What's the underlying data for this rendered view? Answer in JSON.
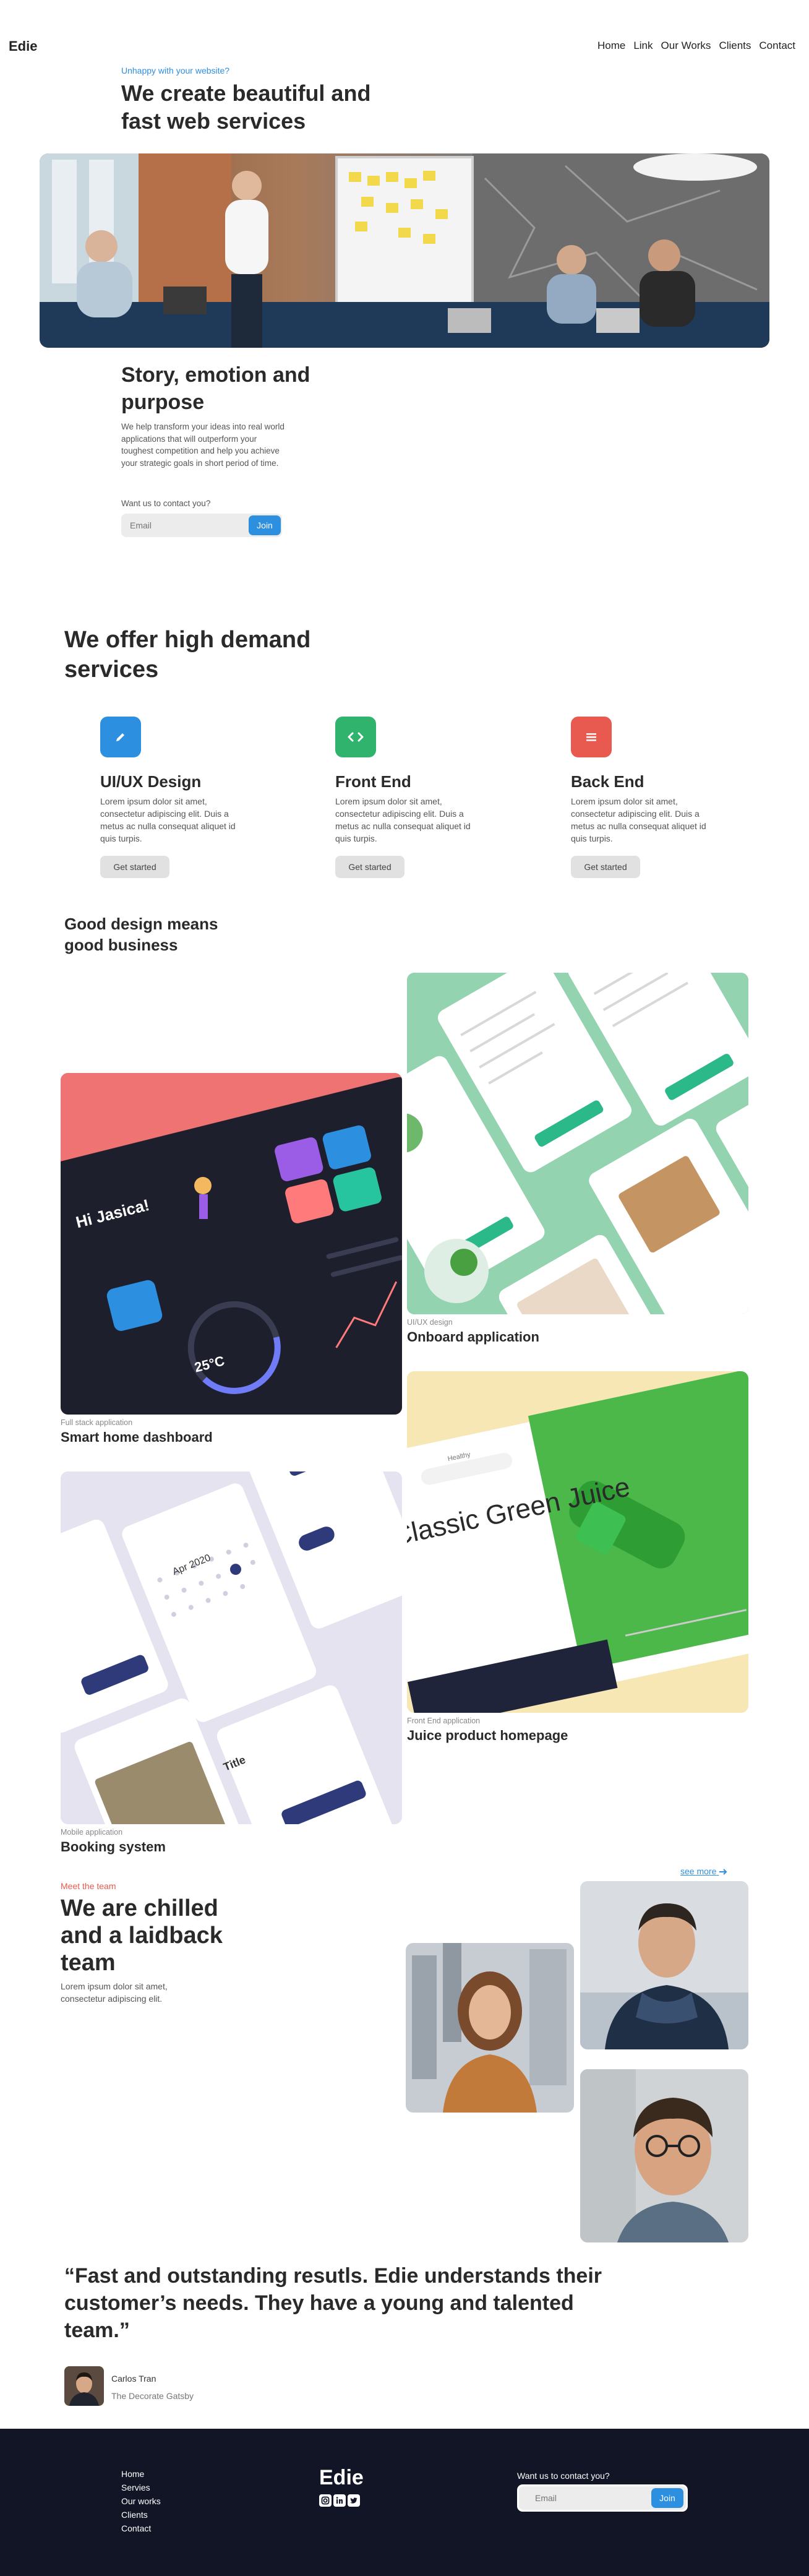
{
  "nav": {
    "brand": "Edie",
    "links": [
      "Home",
      "Link",
      "Our Works",
      "Clients",
      "Contact"
    ]
  },
  "hero": {
    "eyebrow": "Unhappy with your website?",
    "title": "We create beautiful and fast web services"
  },
  "story": {
    "title": "Story, emotion and purpose",
    "text": "We help transform your ideas into real world applications that will outperform your toughest competition and help you achieve your strategic goals in short period of time.",
    "contact_label": "Want us to contact you?",
    "email_placeholder": "Email",
    "join_label": "Join"
  },
  "services": {
    "title": "We offer high demand services",
    "items": [
      {
        "title": "UI/UX Design",
        "text": "Lorem ipsum dolor sit amet, consectetur adipiscing elit. Duis a metus ac nulla consequat aliquet id quis turpis.",
        "button": "Get started",
        "icon": "pencil-icon",
        "color": "#2d8fe0"
      },
      {
        "title": "Front End",
        "text": "Lorem ipsum dolor sit amet, consectetur adipiscing elit. Duis a metus ac nulla consequat aliquet id quis turpis.",
        "button": "Get started",
        "icon": "code-icon",
        "color": "#2fb36d"
      },
      {
        "title": "Back End",
        "text": "Lorem ipsum dolor sit amet, consectetur adipiscing elit. Duis a metus ac nulla consequat aliquet id quis turpis.",
        "button": "Get started",
        "icon": "menu-icon",
        "color": "#e8594f"
      }
    ]
  },
  "works": {
    "title": "Good design means good business",
    "items": [
      {
        "category": "UI/UX design",
        "name": "Onboard application"
      },
      {
        "category": "Full stack application",
        "name": "Smart home dashboard"
      },
      {
        "category": "Front End application",
        "name": "Juice product homepage"
      },
      {
        "category": "Mobile application",
        "name": "Booking system"
      }
    ],
    "mockups": {
      "dashboard_greeting": "Hi Jasica!",
      "dashboard_temp": "25°C",
      "juice_heading": "Classic Green Juice",
      "juice_search": "Healthy",
      "booking_month": "Apr 2020",
      "booking_title": "Title"
    }
  },
  "team": {
    "eyebrow": "Meet the team",
    "title": "We are chilled and a laidback team",
    "text": "Lorem ipsum dolor sit amet, consectetur adipiscing elit.",
    "see_more": "see more"
  },
  "testimonial": {
    "quote": "“Fast and outstanding resutls. Edie understands their customer’s needs. They have a young and talented team.”",
    "author": "Carlos Tran",
    "company": "The Decorate Gatsby"
  },
  "footer": {
    "links": [
      "Home",
      "Servies",
      "Our works",
      "Clients",
      "Contact"
    ],
    "brand": "Edie",
    "social": [
      "instagram-icon",
      "linkedin-icon",
      "twitter-icon"
    ],
    "contact_label": "Want us to contact you?",
    "email_placeholder": "Email",
    "join_label": "Join"
  },
  "colors": {
    "accent": "#2d8fe0",
    "green": "#2fb36d",
    "red": "#e8594f",
    "footer_bg": "#111525"
  }
}
